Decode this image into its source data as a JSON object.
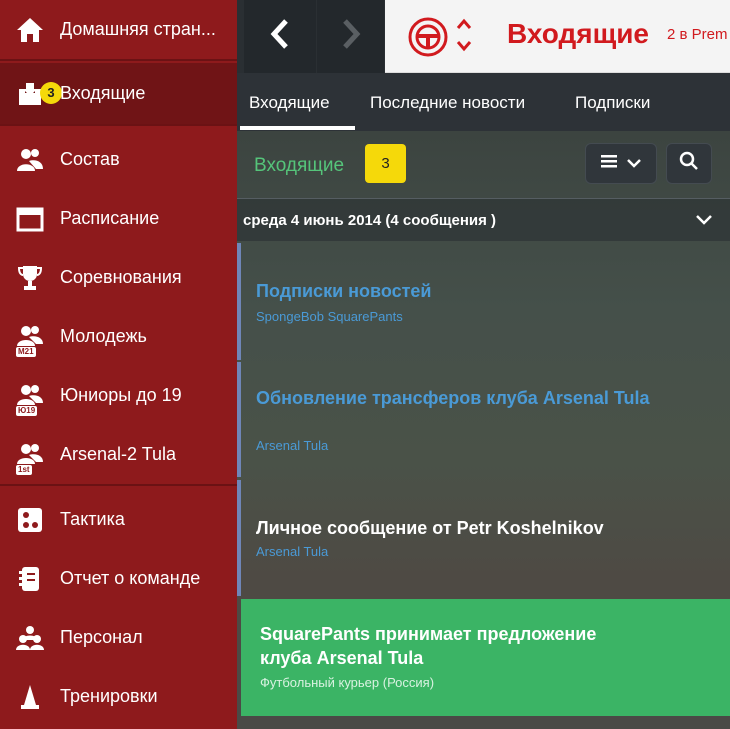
{
  "sidebar": {
    "items": [
      {
        "label": "Домашняя стран...",
        "icon": "home-icon"
      },
      {
        "label": "Входящие",
        "icon": "inbox-icon",
        "badge": "3"
      },
      {
        "label": "Состав",
        "icon": "squad-icon"
      },
      {
        "label": "Расписание",
        "icon": "calendar-icon"
      },
      {
        "label": "Соревнования",
        "icon": "trophy-icon"
      },
      {
        "label": "Молодежь",
        "icon": "youth-team-icon",
        "tag": "M21"
      },
      {
        "label": "Юниоры до 19",
        "icon": "u19-team-icon",
        "tag": "Ю19"
      },
      {
        "label": "Arsenal-2 Tula",
        "icon": "reserve-team-icon",
        "tag": "1st"
      },
      {
        "label": "Тактика",
        "icon": "tactics-icon"
      },
      {
        "label": "Отчет о команде",
        "icon": "team-report-icon"
      },
      {
        "label": "Персонал",
        "icon": "staff-icon"
      },
      {
        "label": "Тренировки",
        "icon": "training-icon"
      }
    ]
  },
  "topbar": {
    "title": "Входящие",
    "subtitle": "2 в Prem"
  },
  "tabs": [
    {
      "label": "Входящие"
    },
    {
      "label": "Последние новости"
    },
    {
      "label": "Подписки"
    }
  ],
  "inbox": {
    "title": "Входящие",
    "count": "3",
    "date_group": "среда 4 июнь 2014 (4 сообщения )"
  },
  "messages": [
    {
      "title": "Подписки новостей",
      "sender": "SpongeBob SquarePants"
    },
    {
      "title": "Обновление трансферов клуба Arsenal Tula",
      "sender": "Arsenal Tula"
    },
    {
      "title": "Личное сообщение от Petr Koshelnikov",
      "sender": "Arsenal Tula"
    },
    {
      "title": "SquarePants принимает предложение клуба Arsenal Tula",
      "sender": "Футбольный курьер (Россия)"
    }
  ],
  "colors": {
    "sidebar": "#8e1a1c",
    "accent_red": "#d11a1e",
    "badge_yellow": "#f5d90a",
    "unread_blue": "#4a9ad6",
    "highlight_green": "#3bb465"
  }
}
